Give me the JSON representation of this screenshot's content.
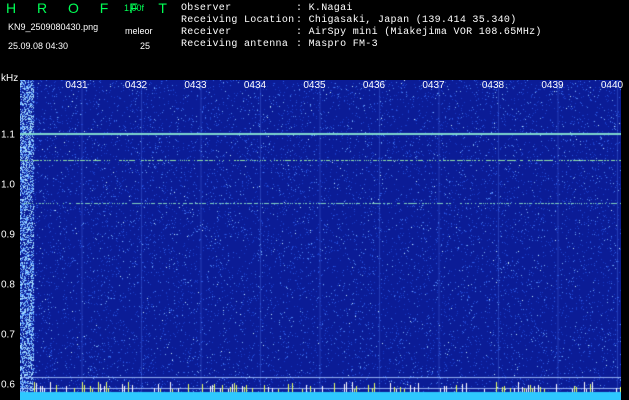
{
  "header": {
    "app_name": "H R O F F T",
    "version": "1.00f",
    "filename": "KN9_2509080430.png",
    "datetime": "25.09.08 04:30",
    "meleor_label": "meleor",
    "meleor_count": "25",
    "info": [
      {
        "label": "Observer",
        "value": ": K.Nagai"
      },
      {
        "label": "Receiving Location",
        "value": ": Chigasaki, Japan (139.414 35.340)"
      },
      {
        "label": "Receiver",
        "value": ": AirSpy mini (Miakejima VOR 108.65MHz)"
      },
      {
        "label": "Receiving antenna",
        "value": ": Maspro FM-3"
      }
    ]
  },
  "colors": {
    "background": "#000000",
    "header_green": "#00ff55",
    "spectrogram_bg": "#0b1c96",
    "echo_line": "#6fd6c6",
    "bottom_band": "#2ec8ff"
  },
  "spectrogram": {
    "y_unit": "kHz",
    "y_ticks": [
      "1.1",
      "1.0",
      "0.9",
      "0.8",
      "0.7",
      "0.6"
    ],
    "y_values": [
      1.1,
      1.0,
      0.9,
      0.8,
      0.7,
      0.6
    ],
    "y_range": [
      0.57,
      1.21
    ],
    "x_ticks": [
      "0431",
      "0432",
      "0433",
      "0434",
      "0435",
      "0436",
      "0437",
      "0438",
      "0439",
      "0440"
    ],
    "x_range_min": [
      0,
      10
    ],
    "x_tick_min": [
      1,
      2,
      3,
      4,
      5,
      6,
      7,
      8,
      9,
      10
    ],
    "horizontal_lines_khz": [
      1.105,
      1.05,
      0.965,
      0.615,
      0.595
    ]
  }
}
